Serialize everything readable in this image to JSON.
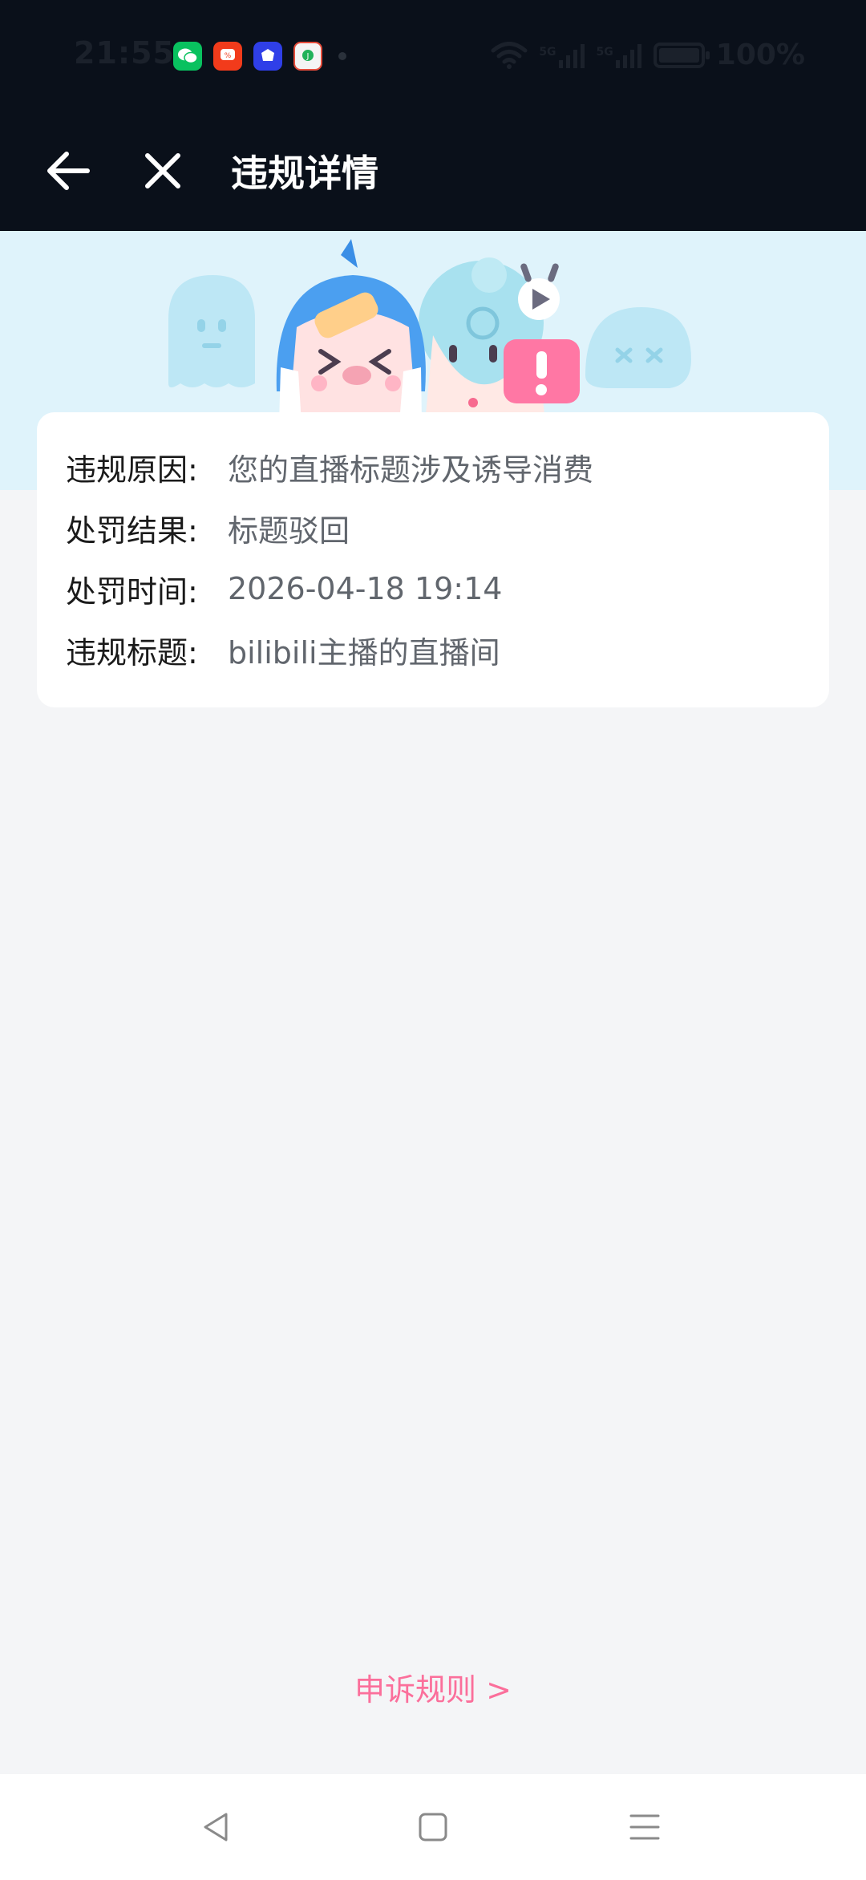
{
  "status_bar": {
    "time": "21:55",
    "signal_1_label": "5G",
    "signal_2_label": "5G",
    "battery": "100%",
    "app_icons": [
      "wechat-icon",
      "shopping-app-icon",
      "baidu-app-icon",
      "green-app-icon"
    ]
  },
  "nav": {
    "title": "违规详情",
    "back_icon": "arrow-left-icon",
    "close_icon": "close-icon"
  },
  "details": [
    {
      "label": "违规原因:",
      "value": "您的直播标题涉及诱导消费"
    },
    {
      "label": "处罚结果:",
      "value": "标题驳回"
    },
    {
      "label": "处罚时间:",
      "value": "2026-04-18 19:14"
    },
    {
      "label": "违规标题:",
      "value": "bilibili主播的直播间"
    }
  ],
  "appeal": {
    "label": "申诉规则 >"
  },
  "colors": {
    "header_bg": "#0a101a",
    "banner_bg": "#dff3fb",
    "page_bg": "#f4f5f7",
    "accent": "#fb6f9b",
    "value_text": "#61666d"
  }
}
